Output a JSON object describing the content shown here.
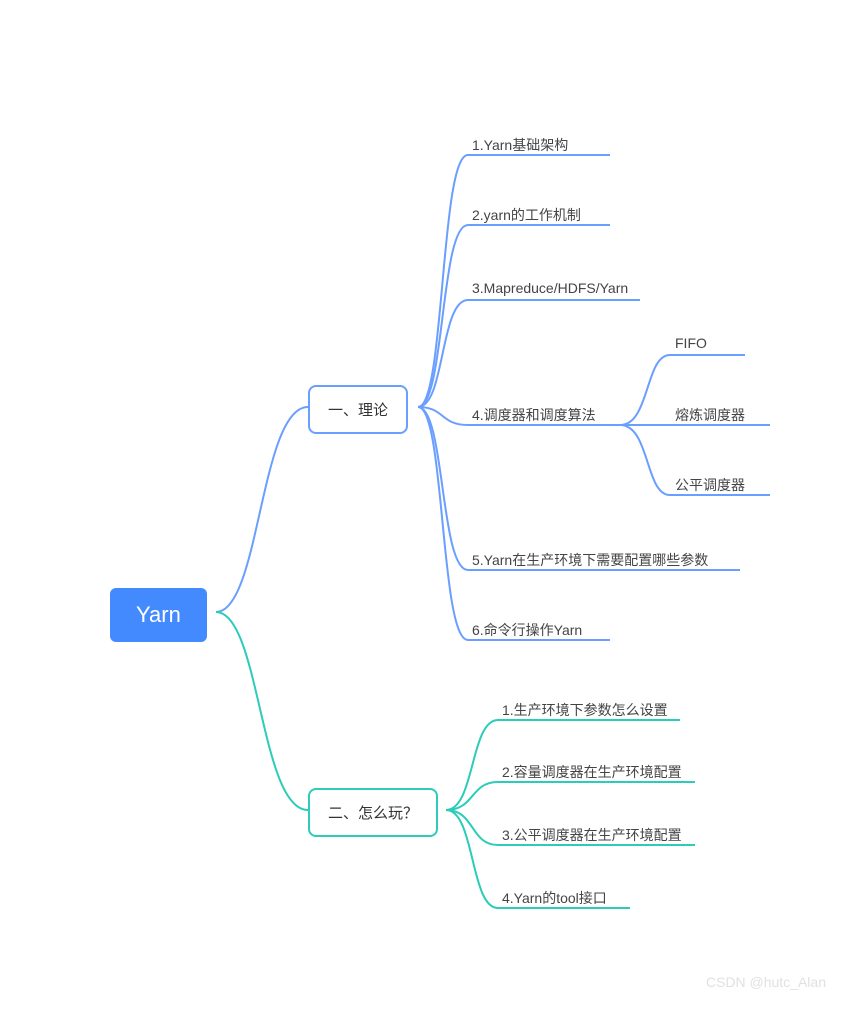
{
  "root": {
    "label": "Yarn"
  },
  "branch1": {
    "label": "一、理论",
    "items": [
      "1.Yarn基础架构",
      "2.yarn的工作机制",
      "3.Mapreduce/HDFS/Yarn",
      "4.调度器和调度算法",
      "5.Yarn在生产环境下需要配置哪些参数",
      "6.命令行操作Yarn"
    ],
    "subitems": [
      "FIFO",
      "熔炼调度器",
      "公平调度器"
    ]
  },
  "branch2": {
    "label": "二、怎么玩？",
    "items": [
      "1.生产环境下参数怎么设置",
      "2.容量调度器在生产环境配置",
      "3.公平调度器在生产环境配置",
      "4.Yarn的tool接口"
    ]
  },
  "watermark": "CSDN @hutc_Alan"
}
